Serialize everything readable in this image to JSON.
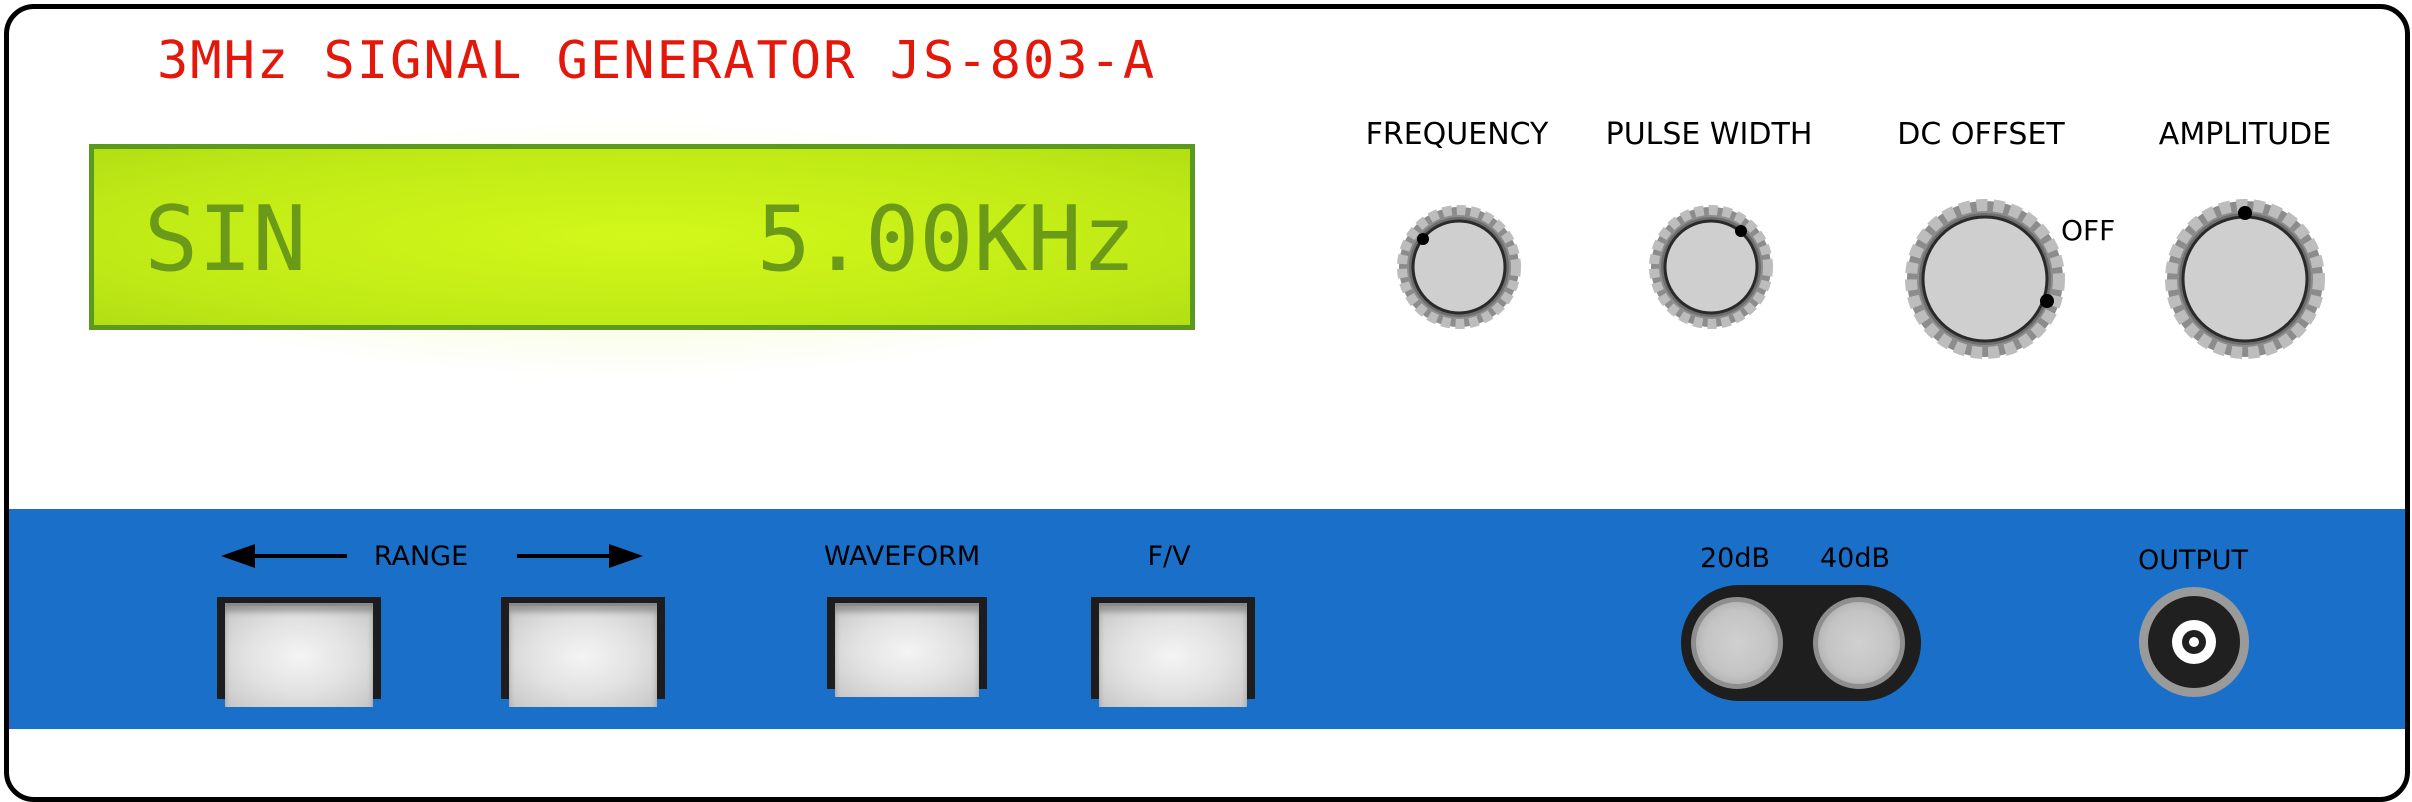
{
  "device": {
    "title": "3MHz SIGNAL GENERATOR JS-803-A"
  },
  "display": {
    "waveform": "SIN",
    "frequency": "5.00KHz"
  },
  "knobs": {
    "frequency": {
      "label": "FREQUENCY"
    },
    "pulse_width": {
      "label": "PULSE WIDTH"
    },
    "dc_offset": {
      "label": "DC OFFSET",
      "off_label": "OFF"
    },
    "amplitude": {
      "label": "AMPLITUDE"
    }
  },
  "controls": {
    "range_label": "RANGE",
    "waveform_label": "WAVEFORM",
    "fv_label": "F/V",
    "att_20_label": "20dB",
    "att_40_label": "40dB",
    "output_label": "OUTPUT"
  },
  "colors": {
    "title": "#e3170a",
    "lcd_background": "#c8f018",
    "lcd_text": "#6b9a18",
    "band": "#1a70c8"
  }
}
